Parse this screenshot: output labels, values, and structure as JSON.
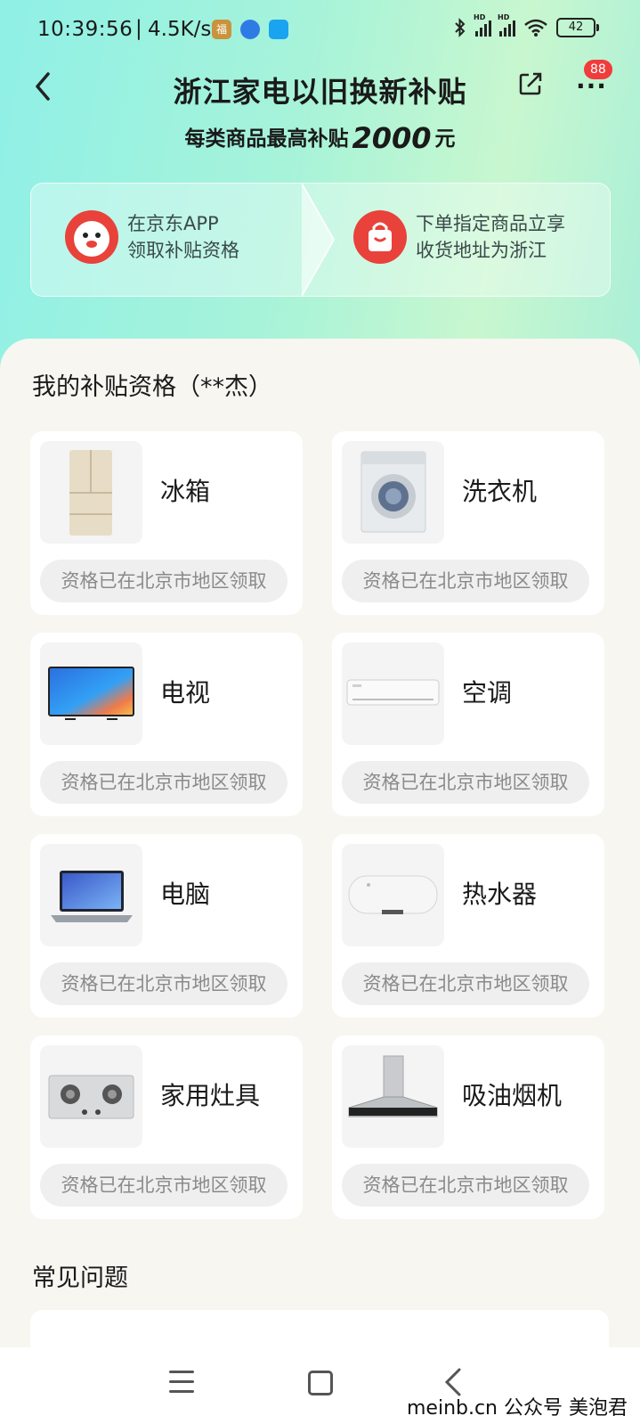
{
  "status_bar": {
    "time": "10:39:56",
    "separator": "|",
    "net_speed": "4.5K/s",
    "app_icon_1": "福",
    "battery": "42",
    "hd_label": "HD"
  },
  "header": {
    "title": "浙江家电以旧换新补贴",
    "subtitle_prefix": "每类商品最高补贴",
    "subtitle_amount": "2000",
    "subtitle_unit": "元",
    "badge": "88"
  },
  "steps": [
    {
      "line1": "在京东APP",
      "line2": "领取补贴资格",
      "icon": "jd-mascot-icon"
    },
    {
      "line1": "下单指定商品立享",
      "line2": "收货地址为浙江",
      "icon": "shopping-bag-icon"
    }
  ],
  "eligibility": {
    "title": "我的补贴资格（**杰）",
    "items": [
      {
        "name": "冰箱",
        "status": "资格已在北京市地区领取",
        "icon": "fridge-icon"
      },
      {
        "name": "洗衣机",
        "status": "资格已在北京市地区领取",
        "icon": "washing-machine-icon"
      },
      {
        "name": "电视",
        "status": "资格已在北京市地区领取",
        "icon": "tv-icon"
      },
      {
        "name": "空调",
        "status": "资格已在北京市地区领取",
        "icon": "air-conditioner-icon"
      },
      {
        "name": "电脑",
        "status": "资格已在北京市地区领取",
        "icon": "laptop-icon"
      },
      {
        "name": "热水器",
        "status": "资格已在北京市地区领取",
        "icon": "water-heater-icon"
      },
      {
        "name": "家用灶具",
        "status": "资格已在北京市地区领取",
        "icon": "gas-stove-icon"
      },
      {
        "name": "吸油烟机",
        "status": "资格已在北京市地区领取",
        "icon": "range-hood-icon"
      }
    ]
  },
  "faq": {
    "title": "常见问题"
  },
  "watermark": "meinb.cn  公众号 美泡君",
  "colors": {
    "accent_red": "#e8423a",
    "badge_red": "#f23b3b"
  }
}
